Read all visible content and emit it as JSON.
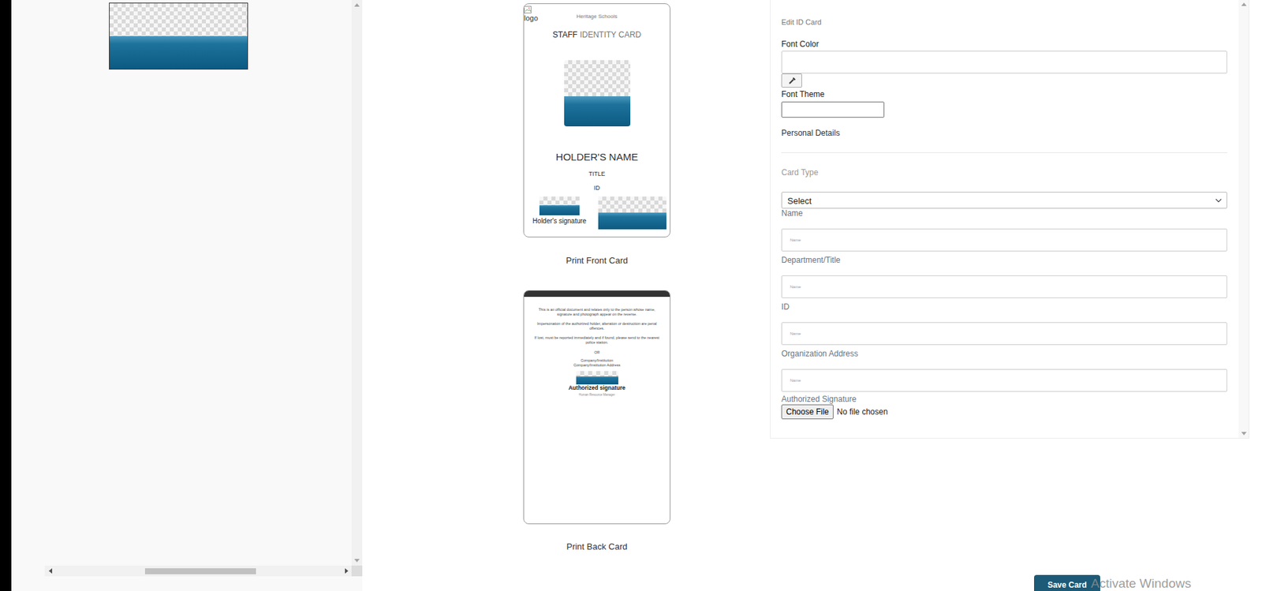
{
  "front_card": {
    "logo_alt": "logo",
    "school": "Heritage Schools",
    "title_bold": "STAFF",
    "title_rest": "IDENTITY CARD",
    "holder_name": "HOLDER'S NAME",
    "job_title": "TITLE",
    "id": "ID",
    "signature_label": "Holder's signature",
    "print": "Print Front Card"
  },
  "back_card": {
    "paragraphs": [
      "This is an official document and relates only to the person whose name, signature and photograph appear on the reverse.",
      "Impersonation of the authorized holder, alteration or destruction are penal offences.",
      "If lost, must be reported immediately and if found, please send to the nearest police station."
    ],
    "or": "OR",
    "company": "Company/Institution",
    "company_address": "Company/Institution Address",
    "signature_label": "Authorized signature",
    "signer": "Human Resource Manager",
    "print": "Print Back Card"
  },
  "editor": {
    "heading": "Edit ID Card",
    "font_color": {
      "label": "Font Color"
    },
    "font_theme": {
      "label": "Font Theme"
    },
    "section": "Personal Details",
    "card_type": {
      "label": "Card Type",
      "value": "Select"
    },
    "fields": [
      {
        "label": "Name",
        "placeholder": "Name"
      },
      {
        "label": "Department/Title",
        "placeholder": "Name"
      },
      {
        "label": "ID",
        "placeholder": "Name"
      },
      {
        "label": "Organization Address",
        "placeholder": "Name"
      }
    ],
    "signature": {
      "label": "Authorized Signature",
      "button": "Choose File",
      "status": "No file chosen"
    }
  },
  "save_button": "Save Card",
  "watermark": "Activate Windows"
}
